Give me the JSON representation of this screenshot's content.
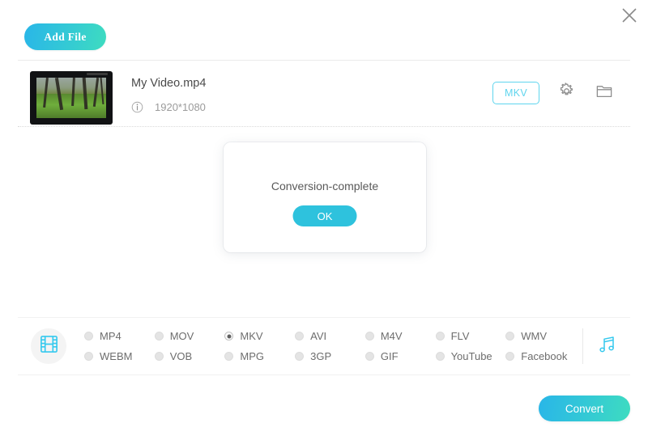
{
  "window": {
    "close_icon": "close-icon"
  },
  "toolbar": {
    "add_file_label": "Add File"
  },
  "file": {
    "name": "My Video.mp4",
    "resolution": "1920*1080",
    "info_icon": "info-icon",
    "output_format": "MKV",
    "settings_icon": "gear-icon",
    "folder_icon": "folder-icon"
  },
  "modal": {
    "message": "Conversion-complete",
    "ok_label": "OK"
  },
  "formats": {
    "video_icon": "film-strip-icon",
    "audio_icon": "music-note-icon",
    "selected": "MKV",
    "options": [
      {
        "label": "MP4",
        "selected": false
      },
      {
        "label": "MOV",
        "selected": false
      },
      {
        "label": "MKV",
        "selected": true
      },
      {
        "label": "AVI",
        "selected": false
      },
      {
        "label": "M4V",
        "selected": false
      },
      {
        "label": "FLV",
        "selected": false
      },
      {
        "label": "WMV",
        "selected": false
      },
      {
        "label": "WEBM",
        "selected": false
      },
      {
        "label": "VOB",
        "selected": false
      },
      {
        "label": "MPG",
        "selected": false
      },
      {
        "label": "3GP",
        "selected": false
      },
      {
        "label": "GIF",
        "selected": false
      },
      {
        "label": "YouTube",
        "selected": false
      },
      {
        "label": "Facebook",
        "selected": false
      }
    ]
  },
  "actions": {
    "convert_label": "Convert"
  },
  "colors": {
    "accent_start": "#29b6e8",
    "accent_end": "#3edcc0",
    "accent_solid": "#2ec2dd",
    "chip_border": "#5fd5ee"
  }
}
